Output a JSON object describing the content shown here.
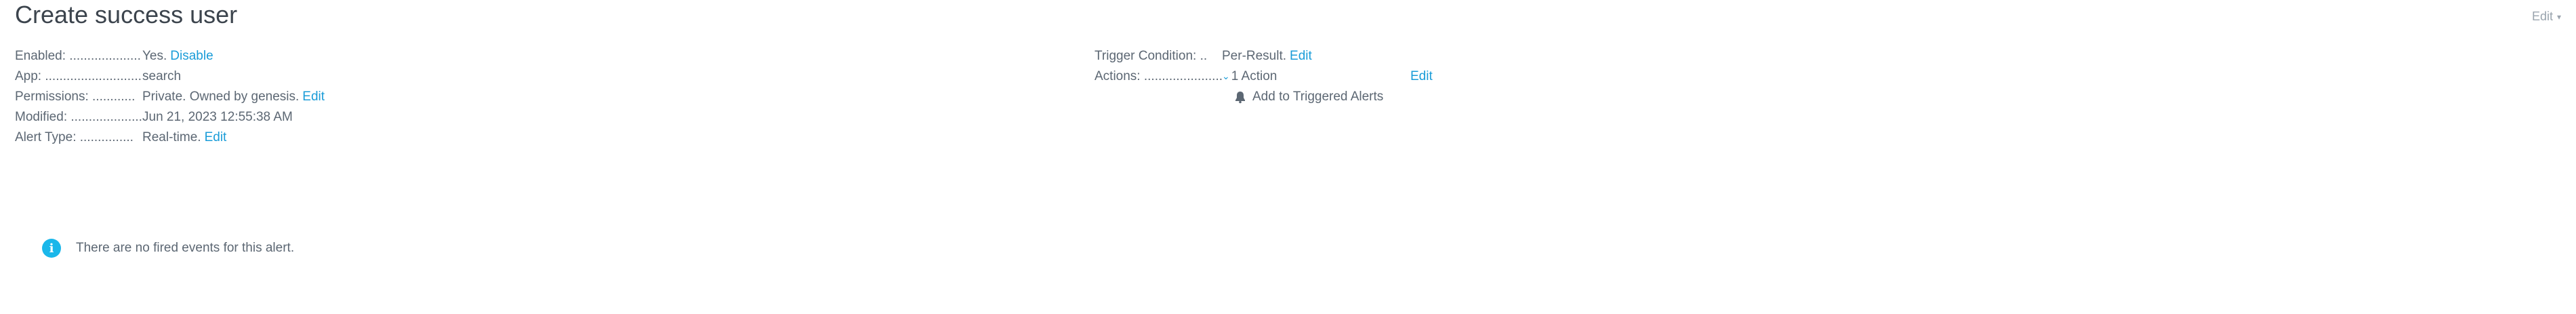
{
  "header": {
    "title": "Create success user",
    "edit_menu_label": "Edit"
  },
  "details_left": {
    "enabled": {
      "label": "Enabled: ....................",
      "value": "Yes.",
      "action": "Disable"
    },
    "app": {
      "label": "App: .............................",
      "value": "search"
    },
    "permissions": {
      "label": "Permissions: ............",
      "value": "Private. Owned by genesis.",
      "action": "Edit"
    },
    "modified": {
      "label": "Modified: ....................",
      "value": "Jun 21, 2023 12:55:38 AM"
    },
    "alert_type": {
      "label": "Alert Type: ...............",
      "value": "Real-time.",
      "action": "Edit"
    }
  },
  "details_right": {
    "trigger_condition": {
      "label": "Trigger Condition: ..",
      "value": "Per-Result.",
      "action": "Edit"
    },
    "actions": {
      "label": "Actions: ......................",
      "value": "1 Action",
      "action": "Edit",
      "items": [
        {
          "icon": "bell-icon",
          "label": "Add to Triggered Alerts"
        }
      ]
    }
  },
  "notice": {
    "icon": "info-icon",
    "text": "There are no fired events for this alert."
  },
  "colors": {
    "link": "#1a9cd8",
    "info": "#1ab7ea",
    "text": "#5c6773",
    "title": "#3c444d"
  }
}
